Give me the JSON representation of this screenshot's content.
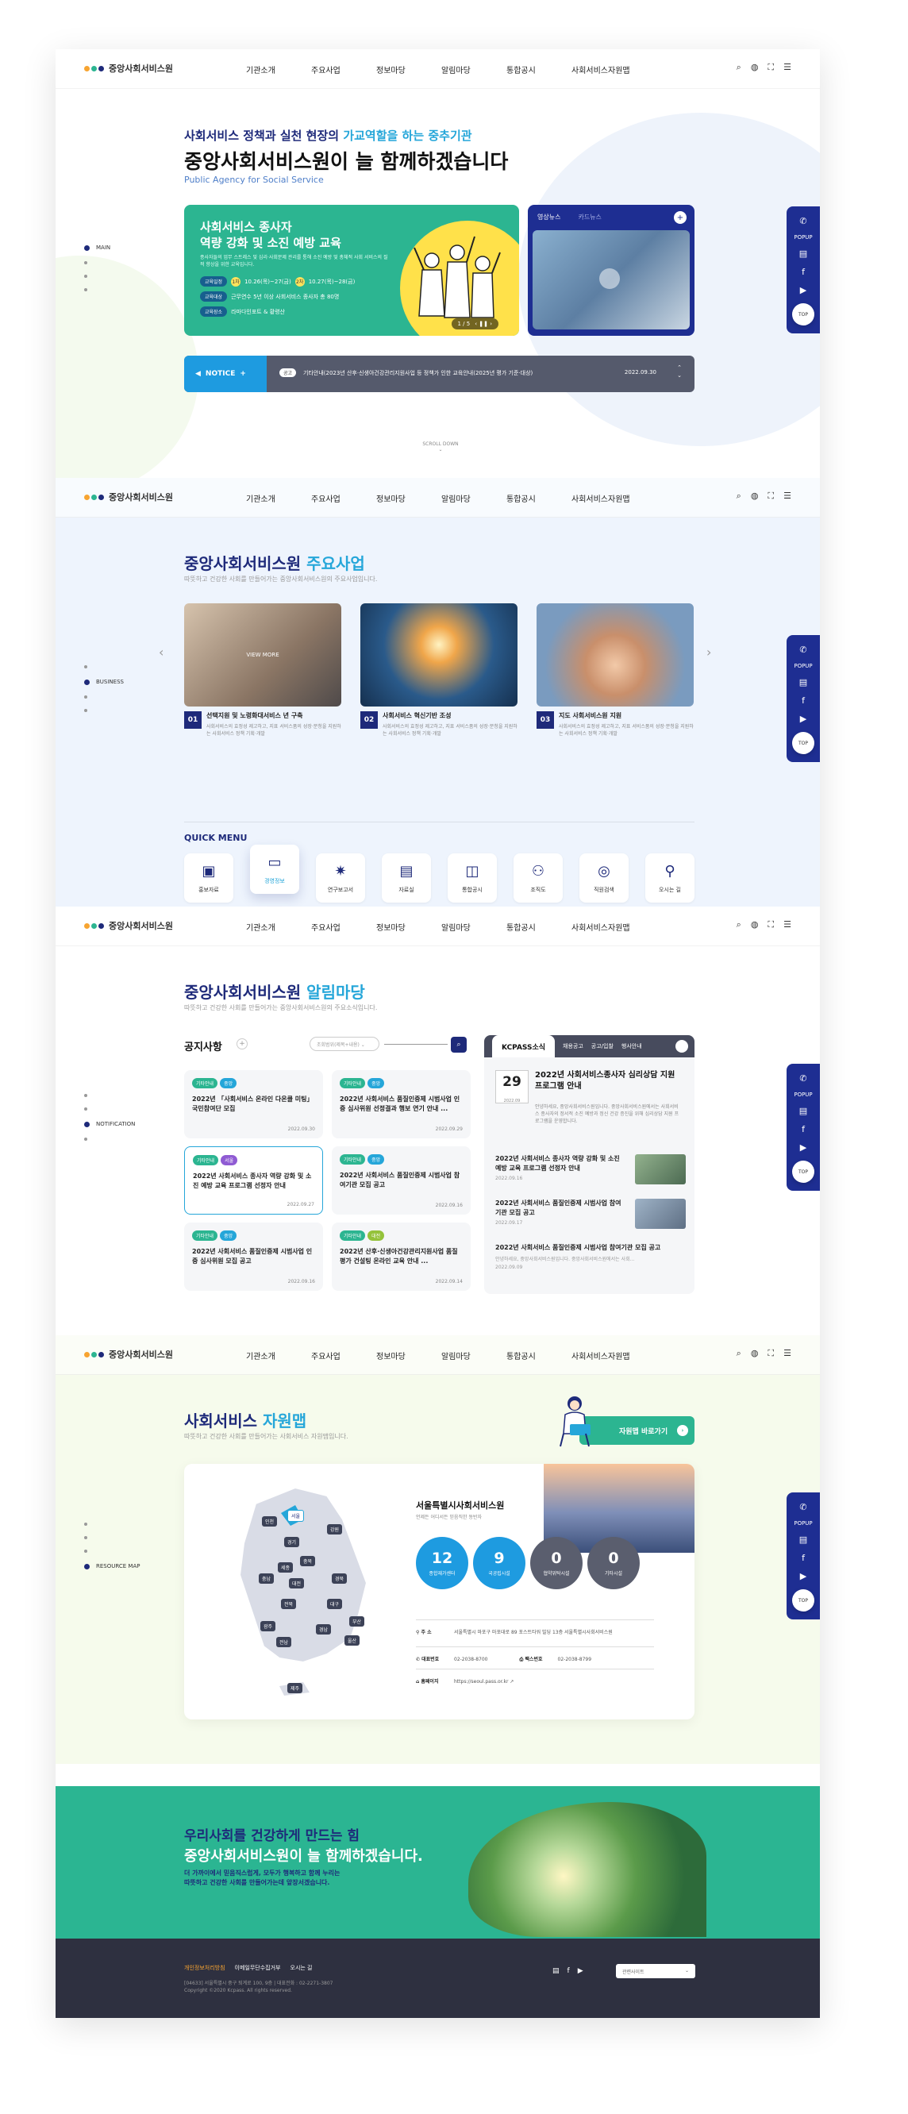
{
  "header": {
    "logo": "중앙사회서비스원",
    "nav": [
      "기관소개",
      "주요사업",
      "정보마당",
      "알림마당",
      "통합공시",
      "사회서비스자원맵"
    ],
    "icons": [
      "search-icon",
      "globe-icon",
      "fullscreen-icon",
      "menu-icon"
    ]
  },
  "floating": {
    "popup": "POPUP",
    "top": "TOP"
  },
  "main": {
    "side": [
      "MAIN",
      "",
      "",
      ""
    ],
    "tag1_pre": "사회서비스 정책과 실천 현장의 ",
    "tag1_hl": "가교역할을 하는 중추기관",
    "tag2": "중앙사회서비스원이 늘 함께하겠습니다",
    "tag3": "Public Agency for Social Service",
    "banner": {
      "title1": "사회서비스 종사자",
      "title2": "역량 강화 및 소진 예방 교육",
      "desc": "종사자들의 업무 스트레스 및 심리·사회문제 관리를 통해 소진 예방 및 총체적 사회 서비스의 질적 향상을 위한 교육입니다.",
      "rows": [
        {
          "pill": "교육일정",
          "c1": "1차",
          "v1": "10.26(목)~27(금)",
          "c2": "2차",
          "v2": "10.27(목)~28(금)"
        },
        {
          "pill": "교육대상",
          "v": "근무연수 5년 이상 사회서비스 종사자 총 80명"
        },
        {
          "pill": "교육장소",
          "v": "라마다인포트 & 황령산"
        }
      ],
      "pager": "1 / 5",
      "pager_ctrl": "‹  ❚❚  ›"
    },
    "video": {
      "tab1": "영상뉴스",
      "tab2": "카드뉴스",
      "plus": "+"
    },
    "notice": {
      "label": "NOTICE",
      "badge": "공고",
      "text": "기타안내(2023년 산후·신생아건강관리지원사업 등 정책가 인한 교육안내(2025년 평가 기준·대상)",
      "date": "2022.09.30"
    },
    "scroll": "SCROLL DOWN"
  },
  "business": {
    "side": [
      "",
      "BUSINESS",
      "",
      ""
    ],
    "title": "중앙사회서비스원",
    "title_hl": "주요사업",
    "sub": "따뜻하고 건강한 사회를 만들어가는 중앙사회서비스원의 주요사업입니다.",
    "items": [
      {
        "num": "01",
        "title": "선택지원 및 노령화대서비스 년 구축",
        "desc": "사회서비스의 효정성 제고하고, 지표 서비스품의 성장·분청을 지원하는 사회서비스 정책 기획·개발",
        "hover": "VIEW MORE"
      },
      {
        "num": "02",
        "title": "사회서비스 혁신기반 조성",
        "desc": "사회서비스의 효정성 제고하고, 지표 서비스품의 성장·분청을 지원하는 사회서비스 정책 기획·개발"
      },
      {
        "num": "03",
        "title": "지도 사회서비스원 지원",
        "desc": "사회서비스의 효정성 제고하고, 지표 서비스품의 성장·분청을 지원하는 사회서비스 정책 기획·개발"
      }
    ],
    "quick_title": "QUICK MENU",
    "quick": [
      {
        "label": "홍보자료",
        "icon": "video-icon"
      },
      {
        "label": "경영정보",
        "icon": "monitor-icon"
      },
      {
        "label": "연구보고서",
        "icon": "bulb-icon"
      },
      {
        "label": "자료실",
        "icon": "doc-icon"
      },
      {
        "label": "통합공시",
        "icon": "screen-icon"
      },
      {
        "label": "조직도",
        "icon": "org-icon"
      },
      {
        "label": "직원검색",
        "icon": "search-user-icon"
      },
      {
        "label": "오시는 길",
        "icon": "map-pin-icon"
      }
    ]
  },
  "notice": {
    "side": [
      "",
      "",
      "NOTIFICATION",
      ""
    ],
    "title": "중앙사회서비스원",
    "title_hl": "알림마당",
    "sub": "따뜻하고 건강한 사회를 만들어가는 중앙사회서비스원의 주요소식입니다.",
    "board_title": "공지사항",
    "select": "조회범위(제목+내용)",
    "cards": [
      {
        "t1": "기타안내",
        "t2": "중앙",
        "title": "2022년 「사회서비스 온라인 다온클 미팅」 국민참여단 모집",
        "date": "2022.09.30"
      },
      {
        "t1": "기타안내",
        "t2": "중앙",
        "title": "2022년 사회서비스 품질인증제 시범사업 인증 심사위원 선정결과 행보 연기 안내 ...",
        "date": "2022.09.29"
      },
      {
        "t1": "기타안내",
        "t2": "서울",
        "title": "2022년 사회서비스 종사자 역량 강화 및 소진 예방 교육 프로그램 선정자 안내",
        "date": "2022.09.27"
      },
      {
        "t1": "기타안내",
        "t2": "중앙",
        "title": "2022년 사회서비스 품질인증제 시범사업 참여기관 모집 공고",
        "date": "2022.09.16"
      },
      {
        "t1": "기타안내",
        "t2": "중앙",
        "title": "2022년 사회서비스 품질인증제 시범사업 인증 심사위원 모집 공고",
        "date": "2022.09.16"
      },
      {
        "t1": "기타안내",
        "t2": "대전",
        "title": "2022년 산후·신생아건강관리지원사업 품질평가 건설팅 온라인 교육 안내 ...",
        "date": "2022.09.14"
      }
    ],
    "kc_tabs": [
      "KCPASS소식",
      "채용공고",
      "공고/입찰",
      "행사안내"
    ],
    "feature": {
      "day": "29",
      "ym": "2022.09",
      "title": "2022년 사회서비스종사자 심리상담 지원 프로그램 안내",
      "desc": "안녕하세요, 중앙사회서비스원입니다. 중앙사회서비스원에서는 사회서비스 종사자의 정서적 소진 예방과 정신 건강 증진을 위해 심리상담 지원 프로그램을 운영합니다."
    },
    "list": [
      {
        "title": "2022년 사회서비스 종사자 역량 강화 및 소진 예방 교육 프로그램 선정자 안내",
        "date": "2022.09.16"
      },
      {
        "title": "2022년 사회서비스 품질인증제 시범사업 참여기관 모집 공고",
        "date": "2022.09.17"
      },
      {
        "title": "2022년 사회서비스 품질인증제 시범사업 참여기관 모집 공고",
        "desc": "안녕하세요, 중앙사회서비스원입니다. 중앙사회서비스원에서는 사회...",
        "date": "2022.09.09"
      }
    ]
  },
  "resource": {
    "side": [
      "",
      "",
      "",
      "RESOURCE MAP"
    ],
    "title": "사회서비스",
    "title_hl": "자원맵",
    "sub": "따뜻하고 건강한 사회를 만들어가는 사회서비스 자원맵입니다.",
    "btn": "자원맵 바로가기",
    "center_name": "서울특별시사회서비스원",
    "center_desc": "언제든 어디서든 믿음직한 동반자",
    "stats": [
      {
        "v": "12",
        "l": "종합재가센터",
        "c": "#1e9be0"
      },
      {
        "v": "9",
        "l": "국공립시설",
        "c": "#1e9be0"
      },
      {
        "v": "0",
        "l": "협약위탁시설",
        "c": "#5a5e6e"
      },
      {
        "v": "0",
        "l": "기타시설",
        "c": "#5a5e6e"
      }
    ],
    "addr_label": "주 소",
    "addr": "서울특별시 마포구 마포대로 89 포스트타워 빌딩 13층 서울특별시사회서비스원",
    "tel_label": "대표번호",
    "tel": "02-2038-8700",
    "fax_label": "팩스번호",
    "fax": "02-2038-8799",
    "web_label": "홈페이지",
    "web": "https://seoul.pass.or.kr",
    "regions": [
      "인천",
      "서울",
      "강원",
      "경기",
      "세종",
      "충북",
      "충남",
      "대전",
      "경북",
      "대구",
      "전북",
      "광주",
      "전남",
      "경남",
      "부산",
      "울산",
      "제주"
    ]
  },
  "slogan": {
    "t1": "우리사회를 건강하게 만드는 힘",
    "t2": "중앙사회서비스원이 늘 함께하겠습니다.",
    "t3a": "더 가까이에서 믿음직스럽게, 모두가 행복하고 함께 누리는",
    "t3b": "따뜻하고 건강한 사회를 만들어가는데 앞장서겠습니다."
  },
  "footer": {
    "links": [
      "개인정보처리방침",
      "이메일무단수집거부",
      "오시는 길"
    ],
    "addr": "[04633] 서울특별시 중구 퇴계로 100, 9층 | 대표전화 : 02-2271-3807",
    "copy": "Copyright ©2020 Kcpass. All rights reserved.",
    "family": "관련사이트"
  },
  "colors": {
    "navy": "#1e2a7a",
    "sky": "#25a6d9",
    "green": "#2cb591"
  }
}
